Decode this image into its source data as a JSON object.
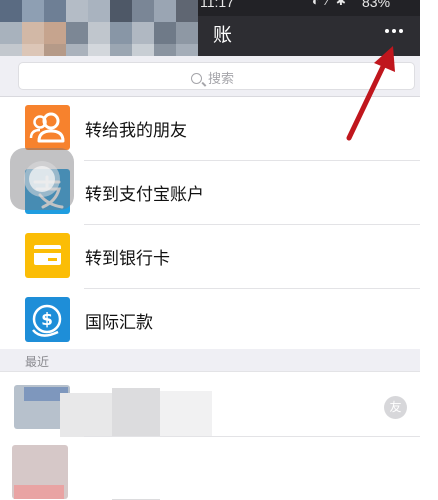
{
  "status_bar": {
    "time": "11:17",
    "battery": "83%"
  },
  "nav": {
    "title": "账"
  },
  "search": {
    "placeholder": "搜索"
  },
  "options": [
    {
      "label": "转给我的朋友",
      "icon": "contacts-icon",
      "color": "#f7822d"
    },
    {
      "label": "转到支付宝账户",
      "icon": "alipay-icon",
      "color": "#1f9de0"
    },
    {
      "label": "转到银行卡",
      "icon": "bank-card-icon",
      "color": "#fbbd06"
    },
    {
      "label": "国际汇款",
      "icon": "dollar-globe-icon",
      "color": "#1e8ed8"
    }
  ],
  "recent": {
    "header": "最近",
    "badge": "友"
  },
  "annotation": {
    "color": "#c0161d"
  }
}
